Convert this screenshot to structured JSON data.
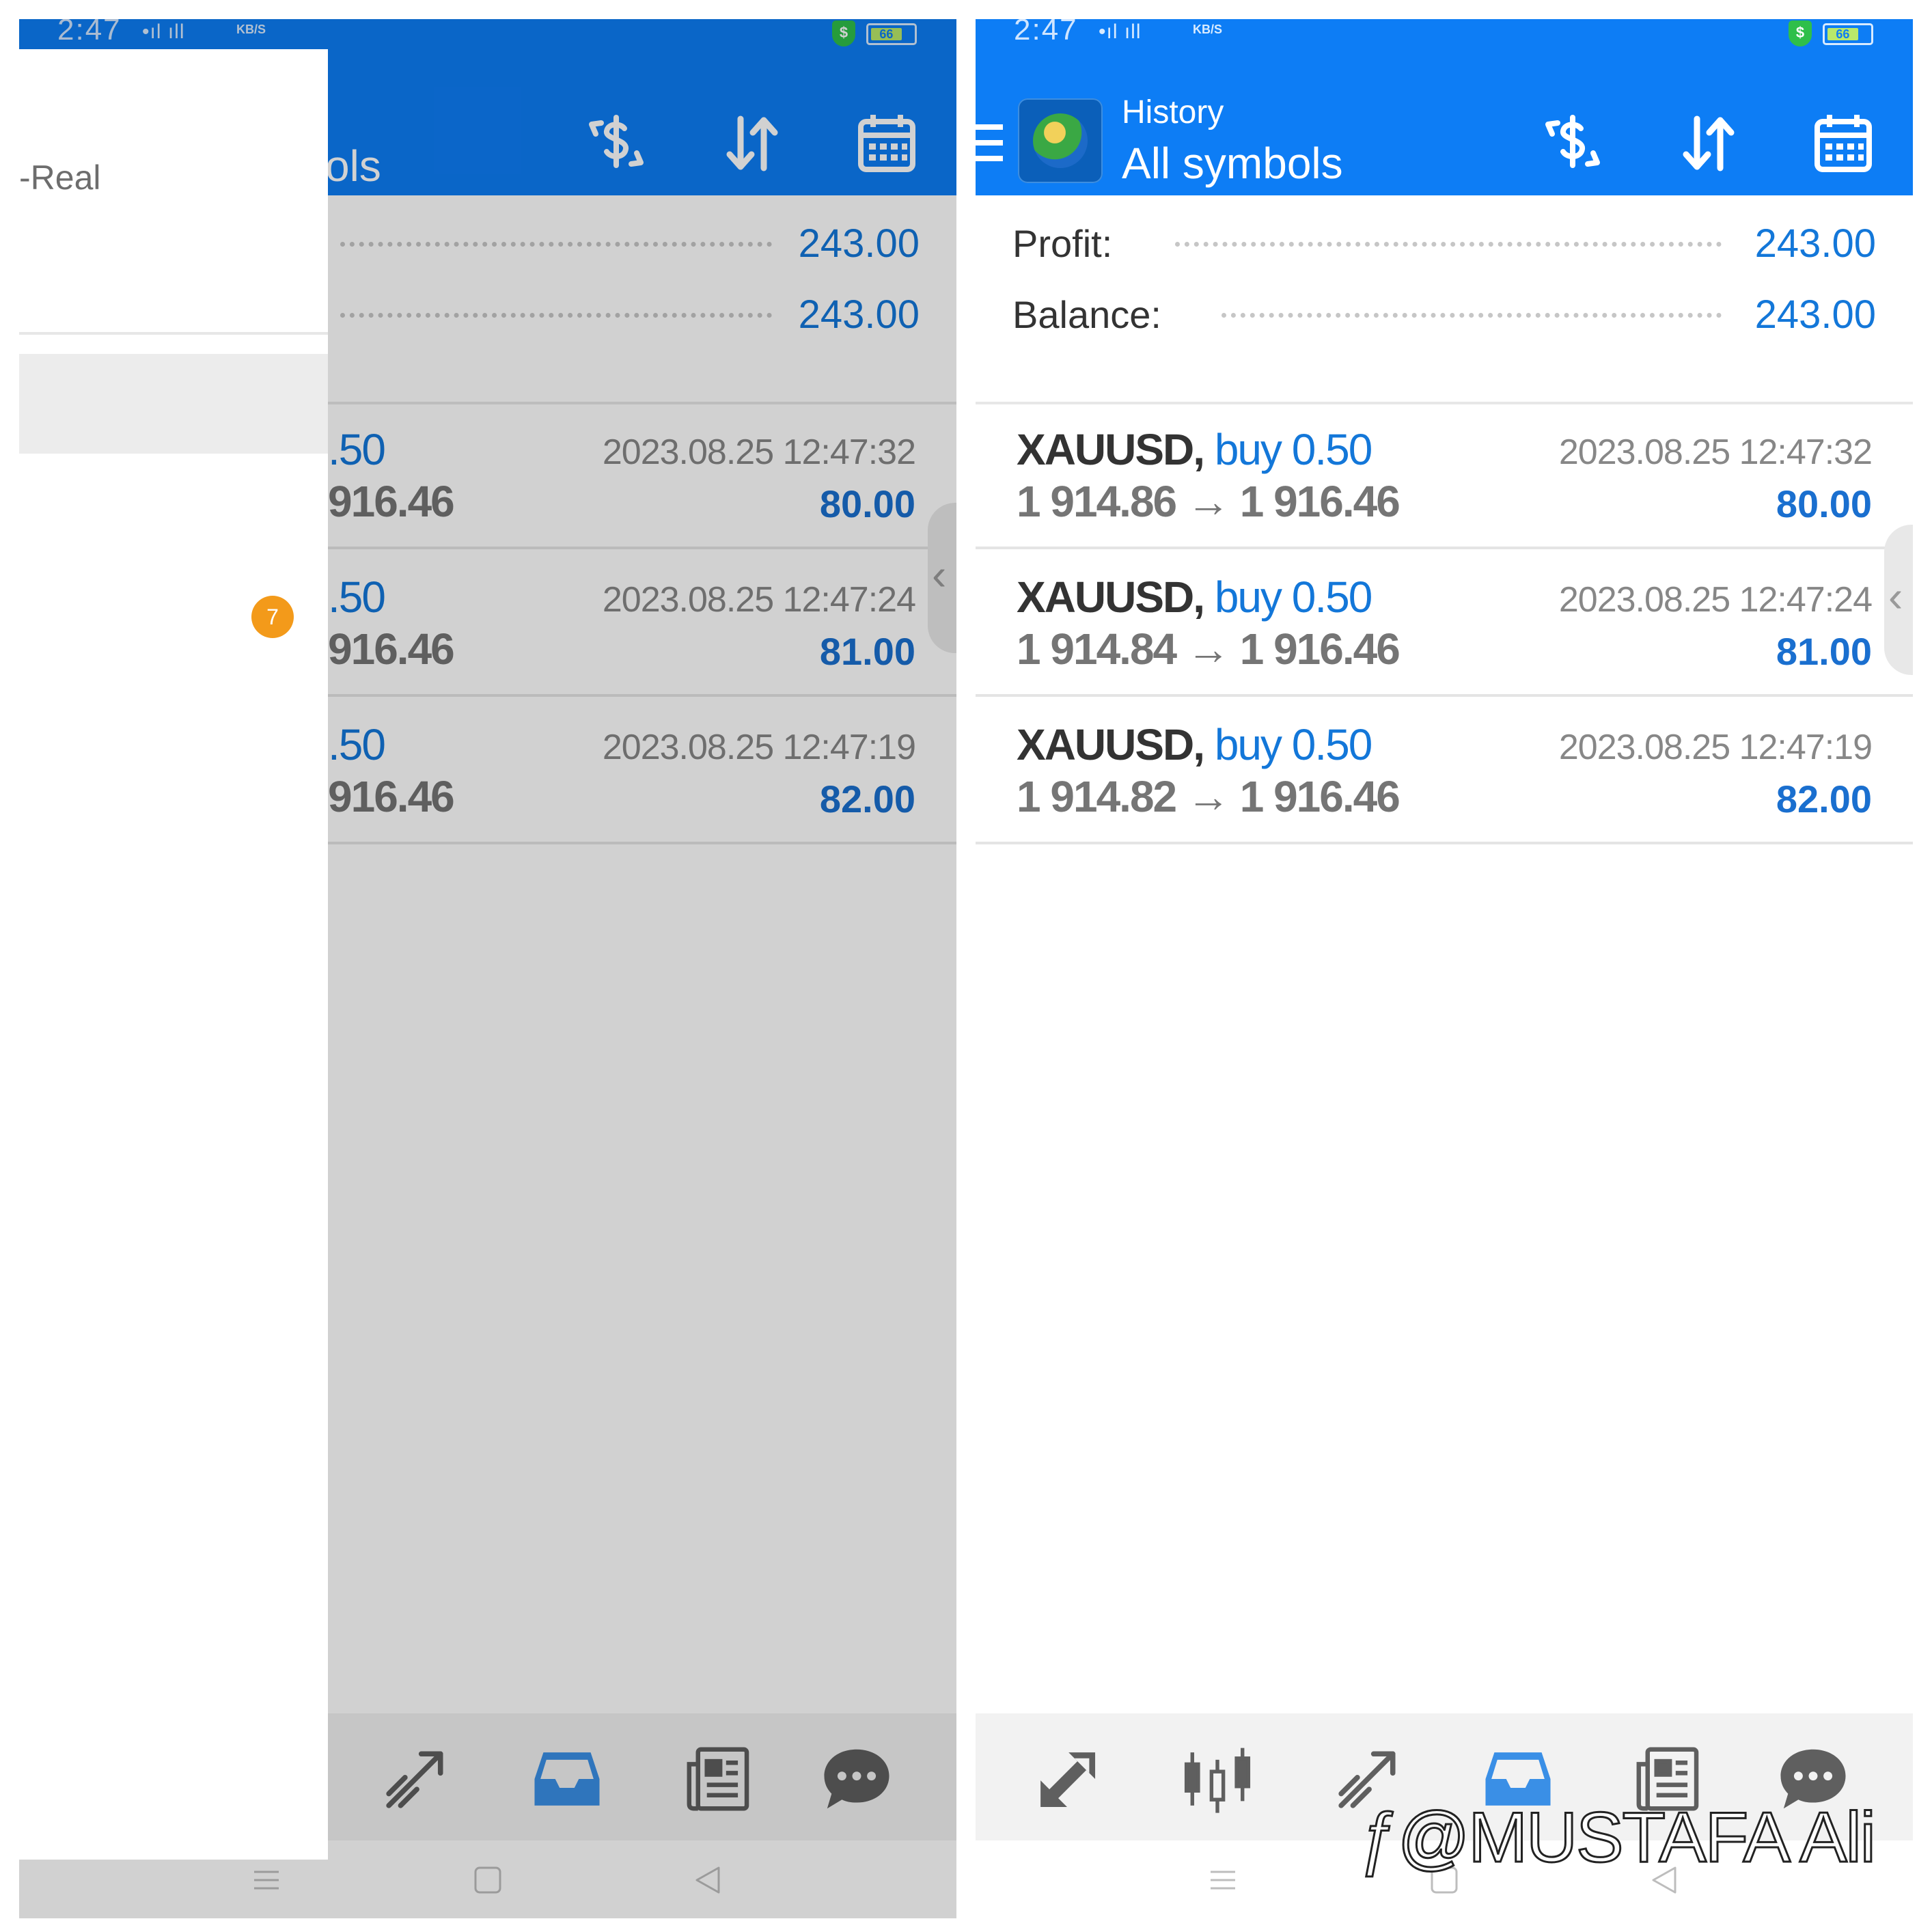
{
  "status_bar": {
    "time": "2:47",
    "signal": "•ıl ıll",
    "network_speed": "KB/S",
    "battery_level": "66",
    "icons": [
      "signal-icon",
      "shield-dollar-icon",
      "battery-icon"
    ]
  },
  "header": {
    "subtitle": "History",
    "title": "All symbols",
    "partial_title": "ols",
    "icons": [
      "hamburger-menu-icon",
      "app-logo-icon",
      "currency-exchange-icon",
      "sort-icon",
      "calendar-icon"
    ]
  },
  "summary": [
    {
      "label": "Profit:",
      "value": "243.00"
    },
    {
      "label": "Balance:",
      "value": "243.00"
    }
  ],
  "deals": [
    {
      "symbol": "XAUUSD,",
      "side": "buy",
      "volume": "0.50",
      "open_price": "1 914.86",
      "close_price": "1 916.46",
      "time": "2023.08.25 12:47:32",
      "profit": "80.00",
      "partial_volume": ".50",
      "partial_close": "916.46"
    },
    {
      "symbol": "XAUUSD,",
      "side": "buy",
      "volume": "0.50",
      "open_price": "1 914.84",
      "close_price": "1 916.46",
      "time": "2023.08.25 12:47:24",
      "profit": "81.00",
      "partial_volume": ".50",
      "partial_close": "916.46"
    },
    {
      "symbol": "XAUUSD,",
      "side": "buy",
      "volume": "0.50",
      "open_price": "1 914.82",
      "close_price": "1 916.46",
      "time": "2023.08.25 12:47:19",
      "profit": "82.00",
      "partial_volume": ".50",
      "partial_close": "916.46"
    }
  ],
  "price_arrow": "→",
  "edge_handle_glyph": "‹",
  "drawer": {
    "account_label": "-Real",
    "badge_count": "7"
  },
  "bottom_nav": {
    "items": [
      "quotes-icon",
      "chart-icon",
      "trade-icon",
      "history-icon",
      "news-icon",
      "chat-icon"
    ],
    "active": "history-icon"
  },
  "system_nav": [
    "menu-icon",
    "home-icon",
    "back-icon"
  ],
  "watermark": "@MUSTAFA Ali",
  "colors": {
    "app_bar": "#0d7df5",
    "accent_blue": "#1377d9",
    "profit_blue": "#1a6fcf",
    "badge_orange": "#f39a1a"
  }
}
